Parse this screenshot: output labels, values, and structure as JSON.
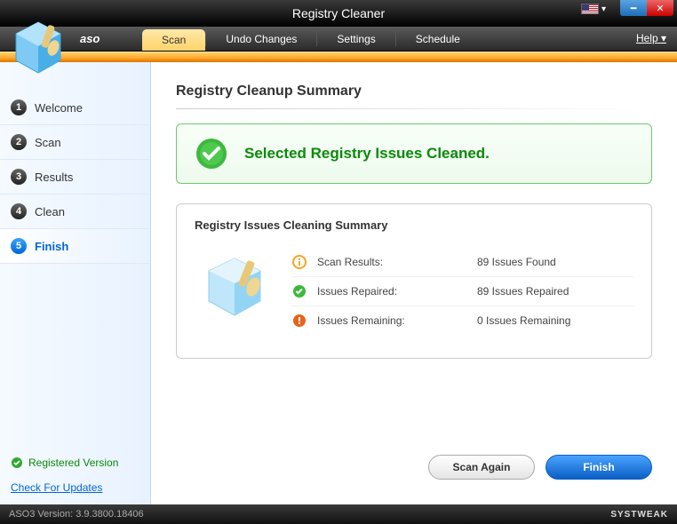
{
  "window": {
    "title": "Registry Cleaner"
  },
  "brand": "aso",
  "tabs": {
    "scan": "Scan",
    "undo": "Undo Changes",
    "settings": "Settings",
    "schedule": "Schedule"
  },
  "help": "Help",
  "sidebar": {
    "steps": [
      {
        "num": "1",
        "label": "Welcome"
      },
      {
        "num": "2",
        "label": "Scan"
      },
      {
        "num": "3",
        "label": "Results"
      },
      {
        "num": "4",
        "label": "Clean"
      },
      {
        "num": "5",
        "label": "Finish"
      }
    ],
    "registered": "Registered Version",
    "check_updates": "Check For Updates"
  },
  "main": {
    "title": "Registry Cleanup Summary",
    "success": "Selected Registry Issues Cleaned.",
    "summary_title": "Registry Issues Cleaning Summary",
    "rows": [
      {
        "label": "Scan Results:",
        "value": "89 Issues Found"
      },
      {
        "label": "Issues Repaired:",
        "value": "89 Issues Repaired"
      },
      {
        "label": "Issues Remaining:",
        "value": "0 Issues Remaining"
      }
    ]
  },
  "buttons": {
    "scan_again": "Scan Again",
    "finish": "Finish"
  },
  "status": {
    "version": "ASO3 Version: 3.9.3800.18406",
    "company": "SYSTWEAK"
  }
}
